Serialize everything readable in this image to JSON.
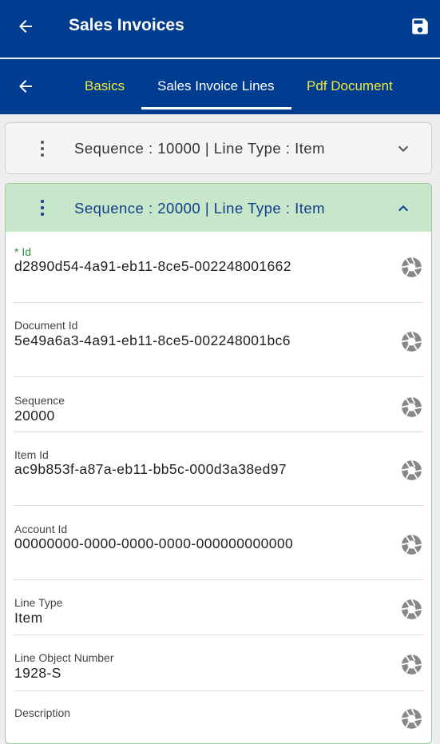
{
  "appbar": {
    "title": "Sales Invoices",
    "back_icon": "arrow-left-icon",
    "save_icon": "floppy-disk-icon"
  },
  "tabs": [
    {
      "label": "Basics",
      "active": false
    },
    {
      "label": "Sales Invoice Lines",
      "active": true
    },
    {
      "label": "Pdf Document",
      "active": false
    }
  ],
  "colors": {
    "primary": "#003c8f",
    "tab_inactive": "#f0ea3c",
    "expanded_header": "#c8e6c9",
    "required_label": "#2e8b3a"
  },
  "lines": [
    {
      "summary": "Sequence   : 10000 | Line Type   : Item",
      "expanded": false
    },
    {
      "summary": "Sequence   : 20000 | Line Type   : Item",
      "expanded": true
    }
  ],
  "fields": [
    {
      "label": "* Id",
      "value": "d2890d54-4a91-eb11-8ce5-002248001662",
      "required": true
    },
    {
      "label": "Document Id",
      "value": "5e49a6a3-4a91-eb11-8ce5-002248001bc6"
    },
    {
      "label": "Sequence",
      "value": "20000"
    },
    {
      "label": "Item Id",
      "value": "ac9b853f-a87a-eb11-bb5c-000d3a38ed97"
    },
    {
      "label": "Account Id",
      "value": "00000000-0000-0000-0000-000000000000"
    },
    {
      "label": "Line Type",
      "value": "Item"
    },
    {
      "label": "Line Object Number",
      "value": "1928-S"
    },
    {
      "label": "Description",
      "value": ""
    }
  ]
}
